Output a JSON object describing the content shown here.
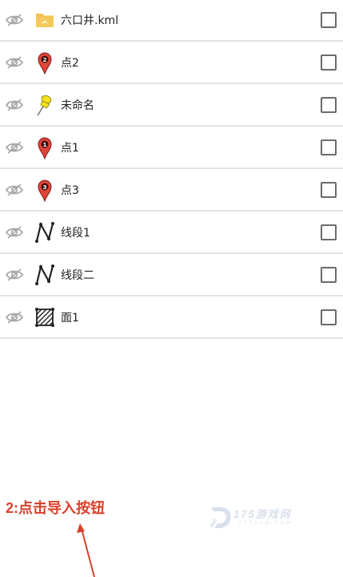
{
  "layers": [
    {
      "icon": "folder-icon",
      "label": "六口井.kml"
    },
    {
      "icon": "marker-2-icon",
      "label": "点2"
    },
    {
      "icon": "pushpin-icon",
      "label": "未命名"
    },
    {
      "icon": "marker-1-icon",
      "label": "点1"
    },
    {
      "icon": "marker-3-icon",
      "label": "点3"
    },
    {
      "icon": "polyline-icon",
      "label": "线段1"
    },
    {
      "icon": "polyline-icon",
      "label": "线段二"
    },
    {
      "icon": "polygon-icon",
      "label": "面1"
    }
  ],
  "annotation": {
    "instruction": "2:点击导入按钮",
    "color": "#d9412a"
  },
  "watermark": {
    "text": "175游戏网",
    "subtext": "175ycw.com"
  },
  "colors": {
    "marker_red": "#e0453a",
    "pushpin_yellow": "#f4e01c",
    "folder_yellow": "#f2c04a",
    "eye_gray": "#a9a9a9",
    "divider": "#e3e3e3"
  }
}
